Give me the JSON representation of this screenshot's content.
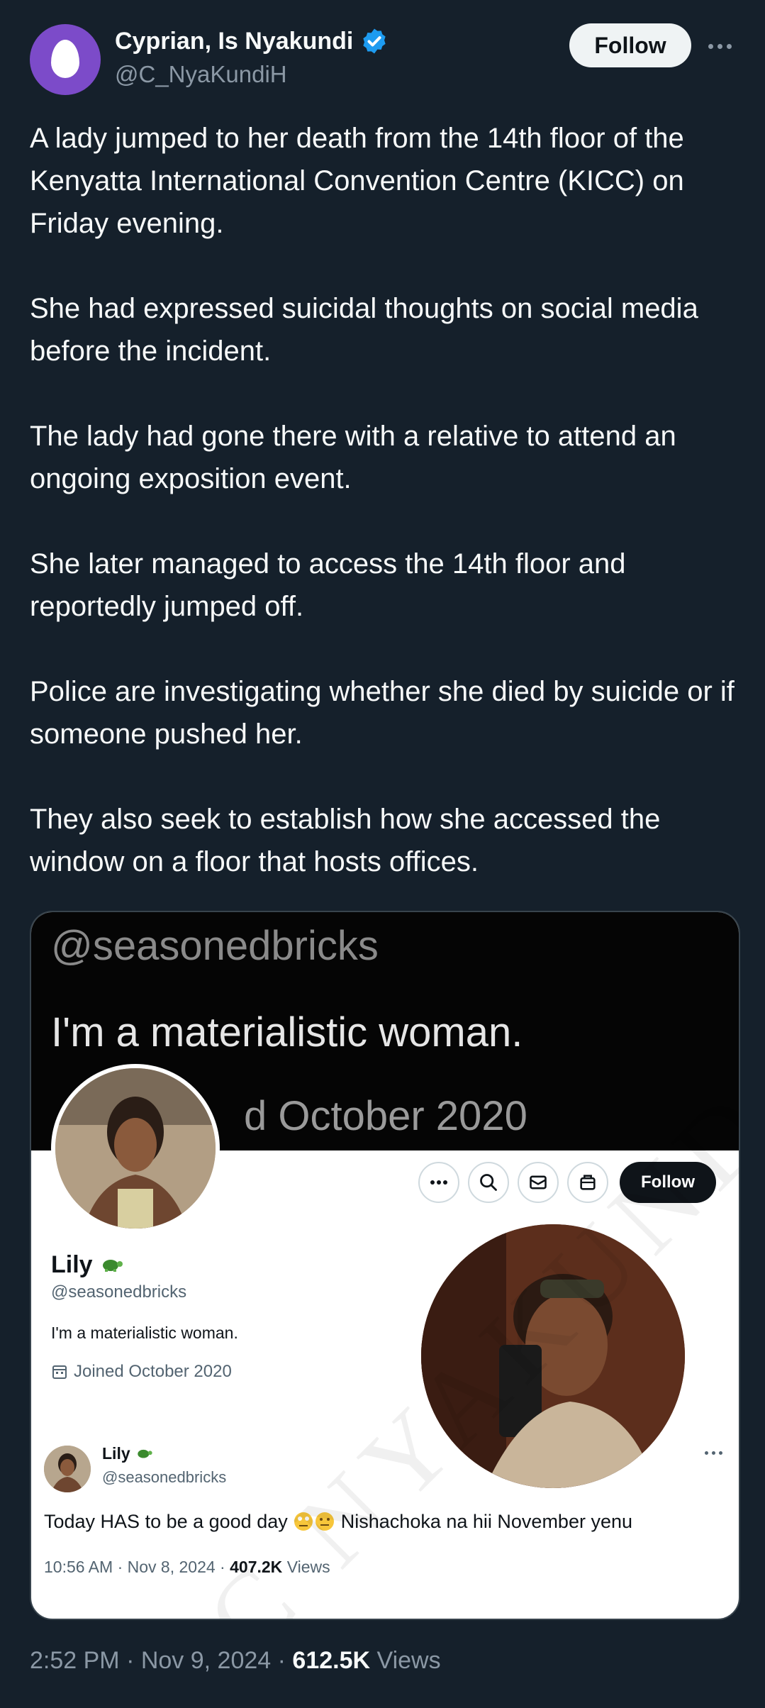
{
  "author": {
    "display_name": "Cyprian, Is Nyakundi",
    "handle": "@C_NyaKundiH",
    "verified": true,
    "follow_label": "Follow",
    "more_icon": "more-horizontal-icon"
  },
  "tweet": {
    "paragraphs": [
      "A lady jumped to her death from the 14th floor of the Kenyatta International Convention Centre (KICC) on Friday evening.",
      "She had expressed suicidal thoughts on social media before the incident.",
      "The lady had gone there with a relative to attend an ongoing exposition event.",
      "She later managed to access the 14th floor and reportedly jumped off.",
      "Police are investigating whether she died by suicide or if someone pushed her.",
      "They also seek to establish how she accessed the window on a floor that hosts offices."
    ],
    "time": "2:52 PM",
    "date": "Nov 9, 2024",
    "views_count": "612.5K",
    "views_label": "Views"
  },
  "media": {
    "banner": {
      "handle": "@seasonedbricks",
      "bio": "I'm a materialistic woman.",
      "joined_fragment": "d October 2020"
    },
    "watermark": "C NYAKUND",
    "profile": {
      "follow_label": "Follow",
      "name": "Lily",
      "handle": "@seasonedbricks",
      "bio": "I'm a materialistic woman.",
      "joined": "Joined October 2020"
    },
    "post": {
      "name": "Lily",
      "handle": "@seasonedbricks",
      "text": "Today HAS to be a good day",
      "text_suffix": "Nishachoka na hii November yenu",
      "time": "10:56 AM",
      "date": "Nov 8, 2024",
      "views_count": "407.2K",
      "views_label": "Views"
    }
  },
  "colors": {
    "background": "#15202b",
    "text": "#f7f9f9",
    "muted": "#8b98a5",
    "verified": "#1d9bf0",
    "avatar": "#7c4bc9"
  }
}
